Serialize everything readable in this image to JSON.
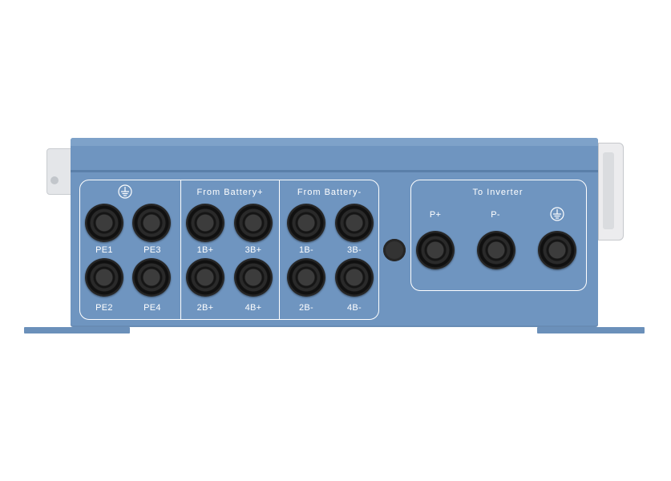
{
  "panels": {
    "left": {
      "ground_icon": "ground-symbol-icon",
      "labels": {
        "pe1": "PE1",
        "pe3": "PE3",
        "pe2": "PE2",
        "pe4": "PE4"
      }
    },
    "battery_plus": {
      "title": "From  Battery+",
      "labels": {
        "b1": "1B+",
        "b3": "3B+",
        "b2": "2B+",
        "b4": "4B+"
      }
    },
    "battery_minus": {
      "title": "From  Battery-",
      "labels": {
        "b1": "1B-",
        "b3": "3B-",
        "b2": "2B-",
        "b4": "4B-"
      }
    },
    "inverter": {
      "title": "To  Inverter",
      "labels": {
        "pplus": "P+",
        "pminus": "P-"
      },
      "ground_icon": "ground-symbol-icon"
    }
  },
  "colors": {
    "enclosure": "#6f95c0",
    "gland": "#1a1a1a",
    "markings": "#ffffff"
  }
}
